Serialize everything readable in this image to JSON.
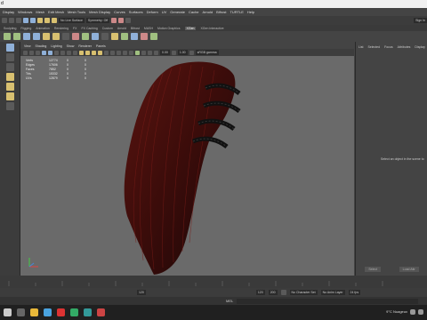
{
  "window": {
    "title": "d"
  },
  "menubar": [
    "Display",
    "Windows",
    "Mesh",
    "Edit Mesh",
    "Mesh Tools",
    "Mesh Display",
    "Curves",
    "Surfaces",
    "Deform",
    "UV",
    "Generate",
    "Cache",
    "Arnold",
    "Bifrost",
    "TURTLE",
    "Help"
  ],
  "statusline": {
    "live_surface": "No Live Surface",
    "symmetry": "Symmetry: Off",
    "sign_in": "Sign In"
  },
  "shelf_tabs": [
    "Sculpting",
    "Rigging",
    "Animation",
    "Rendering",
    "FX",
    "FX Caching",
    "Custom",
    "Arnold",
    "Bifrost",
    "MASH",
    "Motion Graphics",
    "XGen",
    "XGen Interactive"
  ],
  "shelf_active": "XGen",
  "viewport_menu": [
    "View",
    "Shading",
    "Lighting",
    "Show",
    "Renderer",
    "Panels"
  ],
  "viewport_fields": {
    "near": "0.00",
    "far": "1.00",
    "color_space": "sRGB gamma"
  },
  "hud": [
    {
      "label": "Verts",
      "values": [
        "12774",
        "0",
        "0"
      ]
    },
    {
      "label": "Edges",
      "values": [
        "17606",
        "0",
        "0"
      ]
    },
    {
      "label": "Faces",
      "values": [
        "7852",
        "0",
        "0"
      ]
    },
    {
      "label": "Tris",
      "values": [
        "15332",
        "0",
        "0"
      ]
    },
    {
      "label": "UVs",
      "values": [
        "12879",
        "0",
        "0"
      ]
    }
  ],
  "right_panel": {
    "tabs": [
      "List",
      "Selected",
      "Focus",
      "Attributes",
      "Display"
    ],
    "message": "Select an object in the scene to",
    "buttons": [
      "Select",
      "Load Attr"
    ]
  },
  "time_range": {
    "current": "120",
    "start": "120",
    "end": "200"
  },
  "playback": {
    "character_set": "No Character Set",
    "anim_layer": "No Anim Layer",
    "fps": "24 fps"
  },
  "mel_label": "MEL",
  "taskbar": {
    "weather": "9°C Nuageux"
  },
  "colors": {
    "hair_dark": "#2a0a0a",
    "hair_red": "#6a1a14",
    "viewport_bg": "#6a6a6a"
  }
}
